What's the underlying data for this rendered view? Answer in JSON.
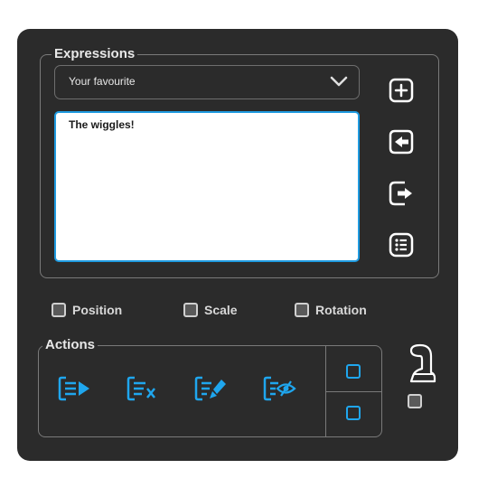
{
  "expressions": {
    "title": "Expressions",
    "dropdown_value": "Your favourite",
    "editor_text": "The wiggles!",
    "buttons": [
      "add-icon",
      "import-icon",
      "export-icon",
      "list-icon"
    ]
  },
  "checkboxes": [
    {
      "label": "Position",
      "checked": false
    },
    {
      "label": "Scale",
      "checked": false
    },
    {
      "label": "Rotation",
      "checked": false
    }
  ],
  "actions": {
    "title": "Actions",
    "buttons": [
      "apply-expression-icon",
      "remove-expression-icon",
      "edit-expression-icon",
      "toggle-expression-visibility-icon"
    ]
  },
  "colors": {
    "panel": "#2b2b2b",
    "accent": "#1fa6ee",
    "text": "#e8e8e8",
    "border": "#7a7a7a"
  }
}
